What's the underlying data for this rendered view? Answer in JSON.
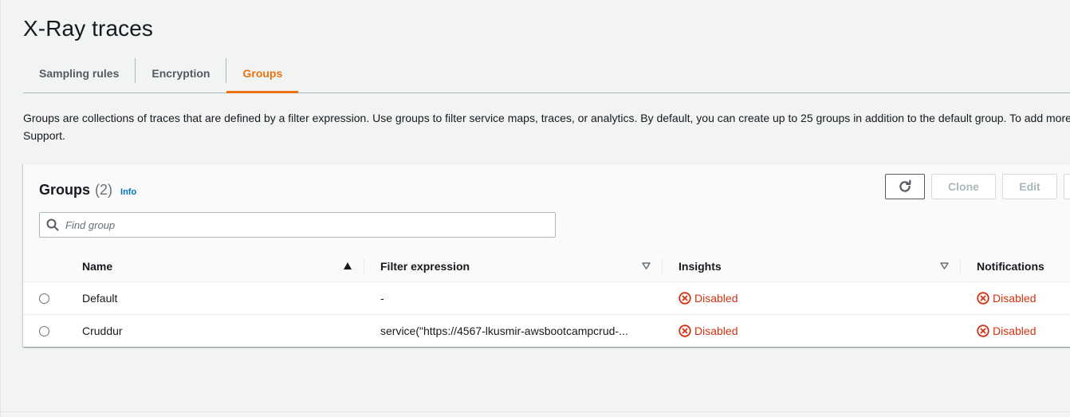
{
  "page": {
    "title": "X-Ray traces"
  },
  "tabs": [
    {
      "label": "Sampling rules",
      "active": false
    },
    {
      "label": "Encryption",
      "active": false
    },
    {
      "label": "Groups",
      "active": true
    }
  ],
  "description": {
    "line1": "Groups are collections of traces that are defined by a filter expression. Use groups to filter service maps, traces, or analytics. By default, you can create up to 25 groups in addition to the default group. To add more groups, contact",
    "line2": "Support."
  },
  "panel": {
    "title": "Groups",
    "count": "(2)",
    "info_label": "Info",
    "buttons": {
      "refresh_icon": "refresh-icon",
      "clone_label": "Clone",
      "edit_label": "Edit"
    },
    "search": {
      "placeholder": "Find group",
      "value": ""
    }
  },
  "table": {
    "columns": {
      "name": "Name",
      "filter": "Filter expression",
      "insights": "Insights",
      "notifications": "Notifications"
    },
    "rows": [
      {
        "name": "Default",
        "filter": "-",
        "insights": "Disabled",
        "notifications": "Disabled"
      },
      {
        "name": "Cruddur",
        "filter": "service(\"https://4567-lkusmir-awsbootcampcrud-...",
        "insights": "Disabled",
        "notifications": "Disabled"
      }
    ]
  },
  "colors": {
    "accent": "#ec7211",
    "link": "#0073bb",
    "error": "#d13212"
  }
}
